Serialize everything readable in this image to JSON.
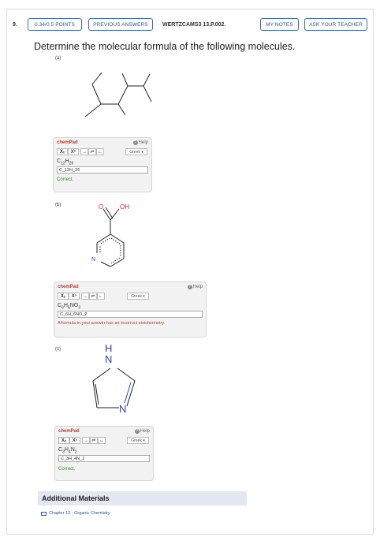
{
  "question": {
    "number": "9.",
    "points": "0.34/0.5 POINTS",
    "previous_answers": "PREVIOUS ANSWERS",
    "course_code": "WERTZCAMS3 13.P.002.",
    "my_notes": "MY NOTES",
    "ask_teacher": "ASK YOUR TEACHER",
    "prompt": "Determine the molecular formula of the following molecules."
  },
  "parts": [
    {
      "label": "(a)",
      "chempad": {
        "title": "chemPad",
        "help": "Help",
        "greek": "Greek ▾",
        "tool_sub": "Xₓ",
        "tool_sup": "Xⁿ",
        "tool_arrow": "→",
        "tool_eq": "⇌",
        "tool_back": "←"
      },
      "formula": {
        "main": "C",
        "sub1": "12",
        "mid": "H",
        "sub2": "26",
        "rest": "",
        "sub3": "",
        "end": ""
      },
      "answer": "C_12H_26",
      "feedback": "Correct.",
      "status": "correct"
    },
    {
      "label": "(b)",
      "chempad": {
        "title": "chemPad",
        "help": "Help",
        "greek": "Greek ▾",
        "tool_sub": "Xₓ",
        "tool_sup": "Xⁿ",
        "tool_arrow": "→",
        "tool_eq": "⇌",
        "tool_back": "←"
      },
      "formula": {
        "main": "C",
        "sub1": "6",
        "mid": "H",
        "sub2": "6",
        "rest": "NO",
        "sub3": "2",
        "end": ""
      },
      "answer": "C_6H_6NO_2",
      "feedback": "A formula in your answer has an incorrect stoichiometry.",
      "status": "incorrect",
      "atoms": {
        "o": "O",
        "oh": "OH",
        "n": "N"
      }
    },
    {
      "label": "(c)",
      "chempad": {
        "title": "chemPad",
        "help": "Help",
        "greek": "Greek ▾",
        "tool_sub": "Xₓ",
        "tool_sup": "Xⁿ",
        "tool_arrow": "→",
        "tool_eq": "⇌",
        "tool_back": "←"
      },
      "formula": {
        "main": "C",
        "sub1": "3",
        "mid": "H",
        "sub2": "4",
        "rest": "N",
        "sub3": "2",
        "end": ""
      },
      "answer": "C_3H_4N_2",
      "feedback": "Correct.",
      "status": "correct",
      "atoms": {
        "h": "H",
        "n1": "N",
        "n2": "N"
      }
    }
  ],
  "additional": {
    "title": "Additional Materials",
    "link": "Chapter 13 - Organic Chemistry"
  },
  "colors": {
    "accent": "#3f6aa8",
    "correct": "#3a8a2e",
    "error": "#c0392b",
    "nitrogen": "#2b3ec7",
    "oxygen": "#d9261c"
  }
}
